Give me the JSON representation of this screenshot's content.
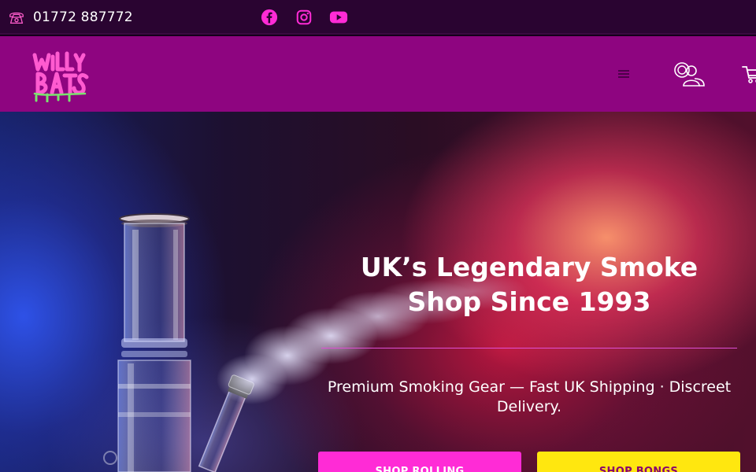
{
  "topbar": {
    "phone": "01772 887772",
    "socials": [
      "facebook-icon",
      "instagram-icon",
      "youtube-icon"
    ]
  },
  "header": {
    "logo_alt": "Willy Bats",
    "icons": [
      "menu-icon",
      "account-icon",
      "cart-icon"
    ]
  },
  "hero": {
    "title": "UK’s Legendary Smoke Shop Since 1993",
    "subtitle": "Premium Smoking Gear — Fast UK Shipping · Discreet Delivery.",
    "buttons": {
      "rolling": "SHOP ROLLING",
      "bongs": "SHOP BONGS"
    }
  },
  "colors": {
    "topbar": "#2a0431",
    "header": "#8e0580",
    "accent_pink": "#ff2bd6",
    "accent_yellow": "#ffe70f"
  }
}
